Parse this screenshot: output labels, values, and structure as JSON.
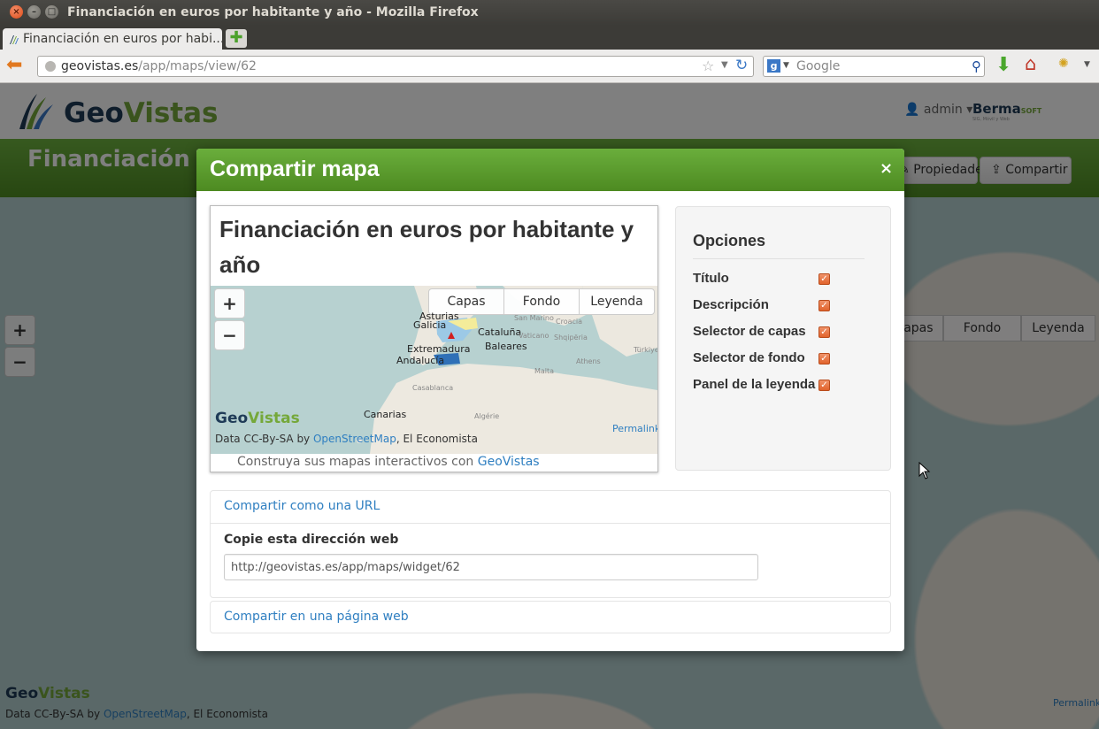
{
  "window": {
    "title": "Financiación en euros por habitante y año - Mozilla Firefox",
    "tab_title": "Financiación en euros por habi...",
    "url_host": "geovistas.es",
    "url_path": "/app/maps/view/62",
    "search_placeholder": "Google"
  },
  "site": {
    "logo_geo": "Geo",
    "logo_vistas": "Vistas",
    "user_menu": "admin",
    "partner_logo": "Berma",
    "partner_logo_suffix": "SOFT",
    "partner_tagline": "SIG, Móvil y Web"
  },
  "page": {
    "map_title": "Financiación en euros por habitante y año",
    "properties_button": "Propiedades",
    "share_button": "Compartir",
    "layer_switcher": {
      "capas": "Capas",
      "fondo": "Fondo",
      "leyenda": "Leyenda"
    },
    "zoom_in": "+",
    "zoom_out": "−",
    "attribution_prefix": "Data CC-By-SA by ",
    "attribution_link": "OpenStreetMap",
    "attribution_suffix": ", El Economista",
    "permalink": "Permalink"
  },
  "modal": {
    "title": "Compartir mapa",
    "close": "×",
    "preview": {
      "title": "Financiación en euros por habitante y año",
      "zoom_in": "+",
      "zoom_out": "−",
      "layer_switcher": {
        "capas": "Capas",
        "fondo": "Fondo",
        "leyenda": "Leyenda"
      },
      "map_labels": {
        "asturias": "Asturias",
        "galicia": "Galicia",
        "cataluna": "Cataluña",
        "extremadura": "Extremadura",
        "baleares": "Baleares",
        "andalucia": "Andalucía",
        "canarias": "Canarias",
        "san_marino": "San Marino",
        "croacia": "Croacia",
        "vaticano": "Vaticano",
        "shqiperia": "Shqipëria",
        "athens": "Athens",
        "malta": "Malta",
        "casablanca": "Casablanca",
        "algerie": "Algérie",
        "turkiye": "Türkiye"
      },
      "logo_geo": "Geo",
      "logo_vistas": "Vistas",
      "attribution_prefix": "Data CC-By-SA by ",
      "attribution_link": "OpenStreetMap",
      "attribution_suffix": ", El Economista",
      "permalink": "Permalink",
      "footer_text": "Construya sus mapas interactivos con ",
      "footer_link": "GeoVistas"
    },
    "options": {
      "title": "Opciones",
      "items": [
        {
          "label": "Título",
          "checked": true
        },
        {
          "label": "Descripción",
          "checked": true
        },
        {
          "label": "Selector de capas",
          "checked": true
        },
        {
          "label": "Selector de fondo",
          "checked": true
        },
        {
          "label": "Panel de la leyenda",
          "checked": true
        }
      ]
    },
    "share_url": {
      "heading": "Compartir como una URL",
      "copy_label": "Copie esta dirección web",
      "url_value": "http://geovistas.es/app/maps/widget/62"
    },
    "share_web": {
      "heading": "Compartir en una página web"
    }
  },
  "colors": {
    "brand_green": "#5d9e30",
    "link_blue": "#2f7fc1",
    "checkbox_orange": "#e1632c",
    "firefox_dark": "#3c3b37"
  }
}
